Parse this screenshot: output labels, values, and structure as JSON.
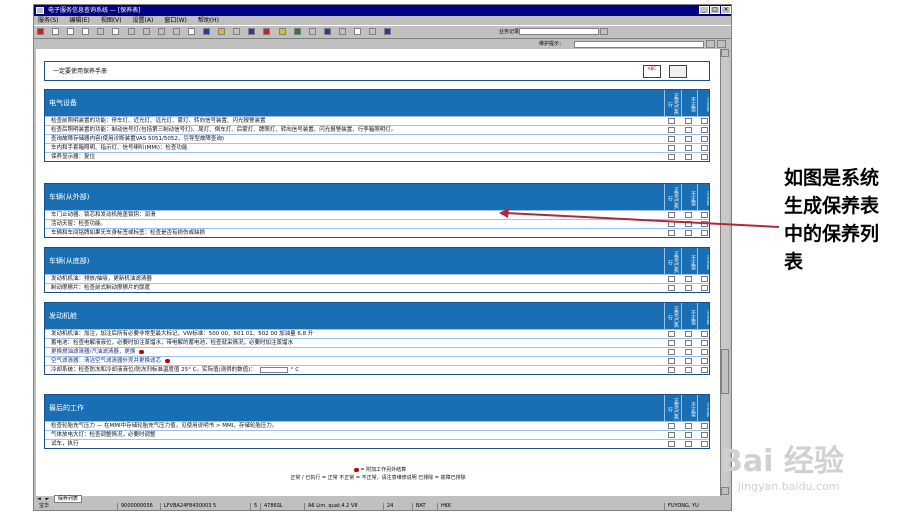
{
  "window": {
    "title": "电子服务信息查询系统 — [保养表]",
    "controls": [
      "_",
      "□",
      "×"
    ]
  },
  "menu": [
    "服务(S)",
    "编辑(E)",
    "视图(V)",
    "设置(A)",
    "窗口(W)",
    "帮助(H)"
  ],
  "toolbar": {
    "business_label": "业务记录："
  },
  "subbar": {
    "label": "维护提示："
  },
  "top_panel": {
    "title": "一定要使用保养手册",
    "icon_abc": "ABC"
  },
  "column_headers": [
    "正常/已执行",
    "不正常",
    "已排除"
  ],
  "sections": [
    {
      "title": "电气设备",
      "items": [
        {
          "text": "检查前照明装置的功能：停车灯、近光灯、远光灯、雾灯、转向信号装置、闪光报警装置"
        },
        {
          "text": "检查后照明装置的功能：制动信号灯(包括第三制动信号灯)、尾灯、倒车灯、后雾灯、牌照灯、转向信号装置、闪光报警装置、行李箱照明灯。"
        },
        {
          "text": "查询故障存储器内容(使用诊断装置VAS 5051/5052，引导型故障查询)"
        },
        {
          "text": "车内和手套箱照明、指示灯、信号喇叭(MMI)：检查功能"
        },
        {
          "text": "保养显示器：复位"
        }
      ]
    },
    {
      "title": "车辆(从外部)",
      "items": [
        {
          "text": "车门止动器、锁芯和发动机舱盖锁钩：润滑"
        },
        {
          "text": "活动天窗：检查功能。"
        },
        {
          "text": "车辆和车间铭牌如果无车身标签或标签：检查是否有损伤或缺损"
        }
      ]
    },
    {
      "title": "车辆(从底部)",
      "items": [
        {
          "text": "发动机机油：排放/抽吸，更新机油滤清器"
        },
        {
          "text": "制动摩擦片：检查前式制动摩擦片的厚度"
        }
      ]
    },
    {
      "title": "发动机舱",
      "items": [
        {
          "text": "发动机机油：加注，加注后所有必要非常型最大标记，VW标准：500 00、501 01、502 00 加油量 6.8 升"
        },
        {
          "text": "蓄电池：检查电解液液位，必要时加注蒸馏水，带电解的蓄电池，检查就采情况，必要时加注蒸馏水"
        },
        {
          "text": "更换燃油滤清器/汽油滤清器，更换",
          "link": true,
          "dot": true
        },
        {
          "text": "空气滤清器：清洁空气滤清器外壳并更换滤芯",
          "link": true,
          "dot": true
        },
        {
          "text": "冷却系统：检查防冻和冷却液液位/防冻剂标准温度值 25° C。实际值(测得的数值)：",
          "temp": true,
          "unit": "° C"
        }
      ]
    },
    {
      "title": "最后的工作",
      "items": [
        {
          "text": "检查轮胎充气压力 — 在MMI中存储轮胎充气压力值，见使用说明书 > MMI，存储轮胎压力。"
        },
        {
          "text": "气体放电大灯：检查调整情况，必要时调整"
        },
        {
          "text": "试车，执行"
        }
      ]
    }
  ],
  "legend": {
    "line1": "= 附加工作另外结算",
    "line2": "正常 / 已执行 = 正常   不正常 = 不正常，请注意维修说明   已排除 = 故障已排除"
  },
  "tabs": {
    "tab_label": "保养列表"
  },
  "status": {
    "fields": [
      "宝华",
      "9000000056",
      "LFVBA24F8430003 5",
      "5",
      "4786SL",
      "A6 Lim. quat.4.2 V8",
      "24",
      "BAT",
      "HKK",
      "FUYONG, YU"
    ]
  },
  "annotation": {
    "text": "如图是系统生成保养表中的保养列表"
  },
  "watermark": {
    "logo": "Bai 经验",
    "url": "jingyan.baidu.com"
  },
  "colors": {
    "title_bar": "#000080",
    "section_header": "#1a6fb4",
    "arrow": "#b0283a",
    "dot": "#c00000"
  }
}
